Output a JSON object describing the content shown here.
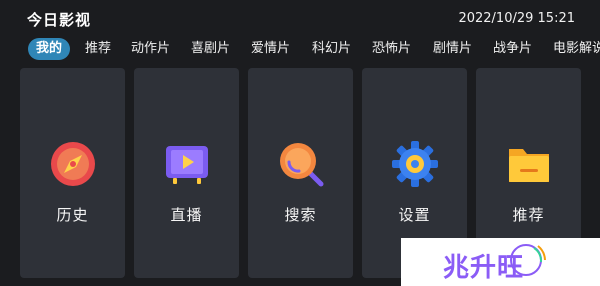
{
  "header": {
    "app_title": "今日影视",
    "datetime": "2022/10/29 15:21"
  },
  "tabs": [
    {
      "label": "我的",
      "active": true
    },
    {
      "label": "推荐"
    },
    {
      "label": "动作片"
    },
    {
      "label": "喜剧片"
    },
    {
      "label": "爱情片"
    },
    {
      "label": "科幻片"
    },
    {
      "label": "恐怖片"
    },
    {
      "label": "剧情片"
    },
    {
      "label": "战争片"
    },
    {
      "label": "电影解说"
    }
  ],
  "cards": [
    {
      "label": "历史",
      "icon": "compass-icon"
    },
    {
      "label": "直播",
      "icon": "tv-icon"
    },
    {
      "label": "搜索",
      "icon": "search-icon"
    },
    {
      "label": "设置",
      "icon": "gear-icon"
    },
    {
      "label": "推荐",
      "icon": "folder-icon"
    }
  ],
  "watermark": {
    "text": "兆升旺"
  },
  "colors": {
    "background": "#1b1c1f",
    "card": "#2e3138",
    "active_tab": "#2f86b7",
    "watermark_text": "#8b5cf6"
  }
}
